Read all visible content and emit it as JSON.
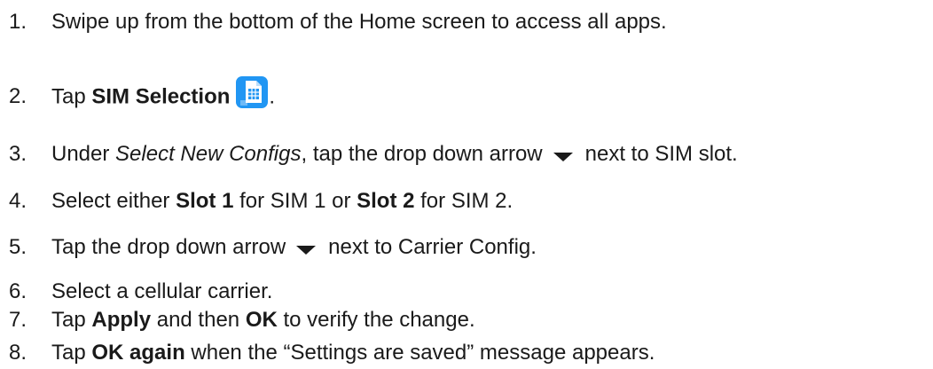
{
  "steps": [
    {
      "num": "1.",
      "text": "Swipe up from the bottom of the Home screen to access all apps."
    },
    {
      "num": "2.",
      "pre": "Tap ",
      "bold": "SIM Selection",
      "icon": "sim-selection-app-icon",
      "post": "."
    },
    {
      "num": "3.",
      "pre": "Under ",
      "italic": "Select New Configs",
      "mid": ", tap the drop down arrow",
      "icon": "dropdown-arrow-icon",
      "post": "next to SIM slot."
    },
    {
      "num": "4.",
      "pre": "Select either ",
      "bold1": "Slot 1",
      "mid1": " for SIM 1 or ",
      "bold2": "Slot 2",
      "post": " for SIM 2."
    },
    {
      "num": "5.",
      "pre": "Tap the drop down arrow",
      "icon": "dropdown-arrow-icon",
      "post": "next to Carrier Config."
    },
    {
      "num": "6.",
      "text": "Select a cellular carrier."
    },
    {
      "num": "7.",
      "pre": "Tap ",
      "bold1": "Apply",
      "mid1": " and then ",
      "bold2": "OK",
      "post": " to verify the change."
    },
    {
      "num": "8.",
      "pre": "Tap ",
      "bold": "OK again",
      "post": " when the “Settings are saved” message appears."
    }
  ],
  "colors": {
    "text": "#1a1a1a",
    "sim_icon_bg": "#2196f3"
  }
}
